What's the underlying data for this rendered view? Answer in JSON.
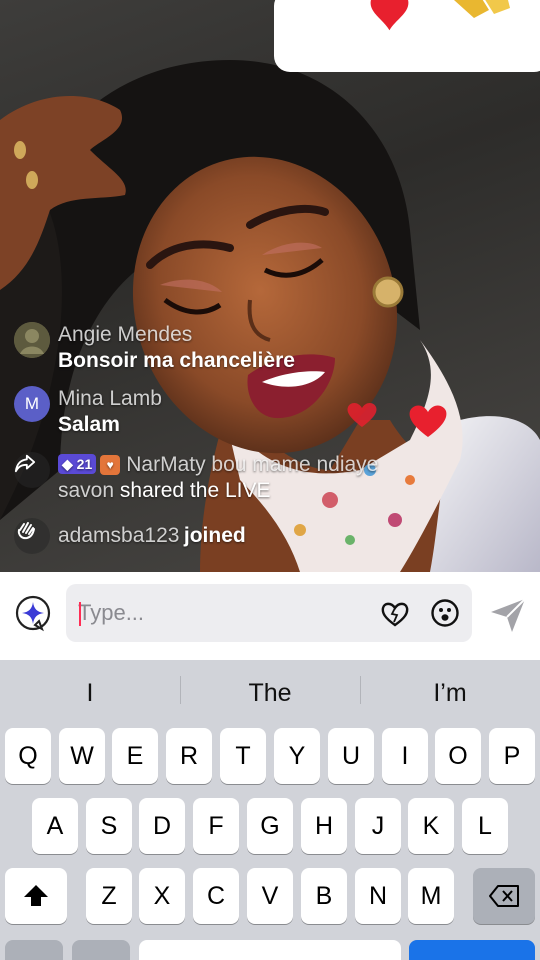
{
  "stream": {
    "gift_panel_icons": [
      "heart-icon",
      "gift-icon"
    ],
    "comments": [
      {
        "name": "Angie Mendes",
        "text": "Bonsoir ma chancelière",
        "avatar": "photo"
      },
      {
        "name": "Mina Lamb",
        "text": "Salam",
        "avatar_letter": "M",
        "avatar_color": "#5b5fc7"
      },
      {
        "badge_level": "21",
        "text": "NarMaty bou mame ndiaye savon",
        "action": "shared the LIVE",
        "icon": "share-icon"
      },
      {
        "name": "adamsba123",
        "action": "joined",
        "icon": "wave-icon"
      }
    ],
    "heart_color": "#e8202e"
  },
  "composer": {
    "placeholder": "Type...",
    "icons": [
      "sparkle-icon",
      "heart-outline-icon",
      "emoji-icon",
      "send-icon"
    ]
  },
  "keyboard": {
    "suggestions": [
      "I",
      "The",
      "I’m"
    ],
    "row1": [
      "Q",
      "W",
      "E",
      "R",
      "T",
      "Y",
      "U",
      "I",
      "O",
      "P"
    ],
    "row2": [
      "A",
      "S",
      "D",
      "F",
      "G",
      "H",
      "J",
      "K",
      "L"
    ],
    "row3": [
      "Z",
      "X",
      "C",
      "V",
      "B",
      "N",
      "M"
    ]
  }
}
